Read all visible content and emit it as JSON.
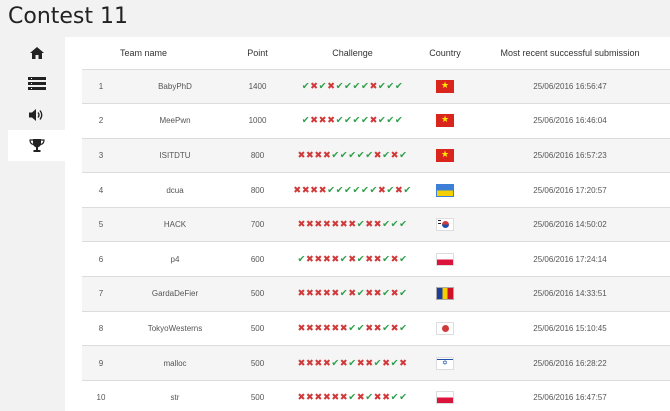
{
  "page": {
    "title": "Contest 11"
  },
  "sidebar": {
    "items": [
      {
        "icon": "home-icon",
        "active": false
      },
      {
        "icon": "list-icon",
        "active": false
      },
      {
        "icon": "announcement-speaker-icon",
        "active": false
      },
      {
        "icon": "trophy-icon",
        "active": true
      }
    ]
  },
  "table": {
    "headers": {
      "rank": "",
      "name": "Team name",
      "point": "Point",
      "challenge": "Challenge",
      "country": "Country",
      "submission": "Most recent successful submission"
    },
    "rows": [
      {
        "rank": "1",
        "name": "BabyPhD",
        "point": "1400",
        "challenge": "✔✖✔✖✔✔✔✔✖✔✔✔",
        "country": "vn",
        "submission": "25/06/2016 16:56:47"
      },
      {
        "rank": "2",
        "name": "MeePwn",
        "point": "1000",
        "challenge": "✔✖✖✖✔✔✔✔✖✔✔✔",
        "country": "vn",
        "submission": "25/06/2016 16:46:04"
      },
      {
        "rank": "3",
        "name": "ISITDTU",
        "point": "800",
        "challenge": "✖✖✖✖✔✔✔✔✔✖✔✖✔",
        "country": "vn",
        "submission": "25/06/2016 16:57:23"
      },
      {
        "rank": "4",
        "name": "dcua",
        "point": "800",
        "challenge": "✖✖✖✖✔✔✔✔✔✔✖✔✖✔",
        "country": "ua",
        "submission": "25/06/2016 17:20:57"
      },
      {
        "rank": "5",
        "name": "HACK",
        "point": "700",
        "challenge": "✖✖✖✖✖✖✖✔✖✖✔✔✔",
        "country": "kr",
        "submission": "25/06/2016 14:50:02"
      },
      {
        "rank": "6",
        "name": "p4",
        "point": "600",
        "challenge": "✔✖✖✖✖✔✖✔✖✖✔✖✔",
        "country": "pl",
        "submission": "25/06/2016 17:24:14"
      },
      {
        "rank": "7",
        "name": "GardaDeFier",
        "point": "500",
        "challenge": "✖✖✖✖✖✔✖✔✖✖✔✖✔",
        "country": "ro",
        "submission": "25/06/2016 14:33:51"
      },
      {
        "rank": "8",
        "name": "TokyoWesterns",
        "point": "500",
        "challenge": "✖✖✖✖✖✖✔✔✖✖✔✖✔",
        "country": "jp",
        "submission": "25/06/2016 15:10:45"
      },
      {
        "rank": "9",
        "name": "malloc",
        "point": "500",
        "challenge": "✖✖✖✖✔✖✔✖✖✔✖✔✖",
        "country": "il",
        "submission": "25/06/2016 16:28:22"
      },
      {
        "rank": "10",
        "name": "str",
        "point": "500",
        "challenge": "✖✖✖✖✖✖✔✖✔✖✖✔✔",
        "country": "pl",
        "submission": "25/06/2016 16:47:57"
      }
    ]
  },
  "colors": {
    "ok": "#2e9e4a",
    "fail": "#d03a3a"
  }
}
